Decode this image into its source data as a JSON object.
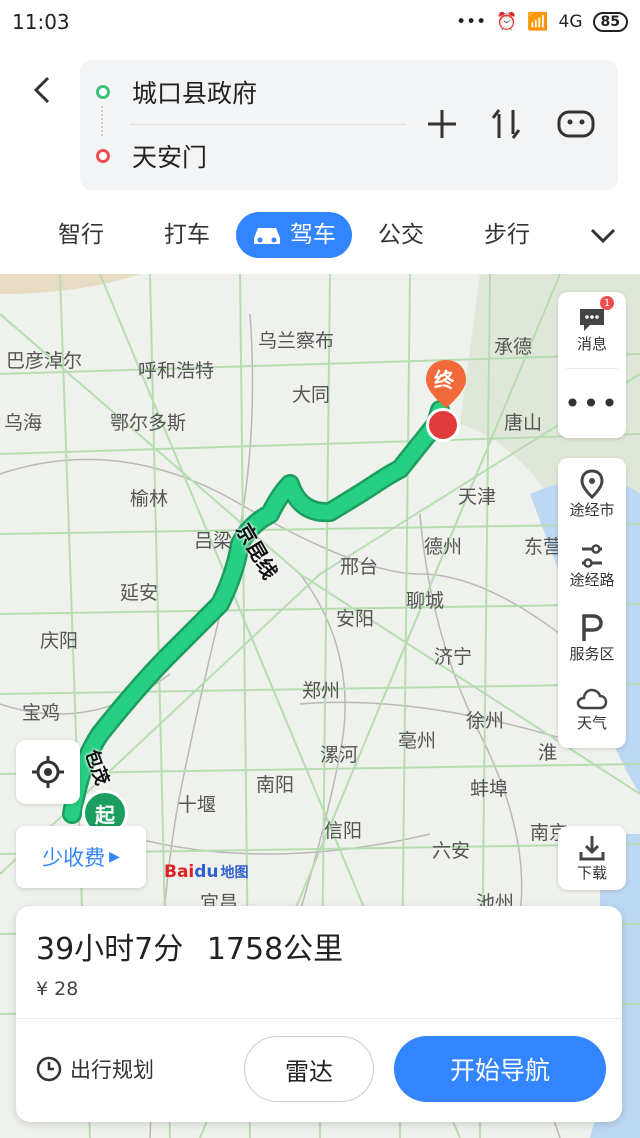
{
  "status": {
    "time": "11:03",
    "dots": "•••",
    "network": "4G",
    "battery": "85"
  },
  "route": {
    "start": "城口县政府",
    "end": "天安门"
  },
  "modes": [
    "智行",
    "打车",
    "驾车",
    "公交",
    "步行"
  ],
  "selected_mode": "驾车",
  "map": {
    "cities": [
      {
        "name": "乌兰察布"
      },
      {
        "name": "承德"
      },
      {
        "name": "巴彦淖尔"
      },
      {
        "name": "呼和浩特"
      },
      {
        "name": "大同"
      },
      {
        "name": "乌海"
      },
      {
        "name": "鄂尔多斯"
      },
      {
        "name": "唐山"
      },
      {
        "name": "天津"
      },
      {
        "name": "榆林"
      },
      {
        "name": "吕梁"
      },
      {
        "name": "德州"
      },
      {
        "name": "东营"
      },
      {
        "name": "延安"
      },
      {
        "name": "邢台"
      },
      {
        "name": "聊城"
      },
      {
        "name": "庆阳"
      },
      {
        "name": "安阳"
      },
      {
        "name": "济宁"
      },
      {
        "name": "郑州"
      },
      {
        "name": "宝鸡"
      },
      {
        "name": "徐州"
      },
      {
        "name": "漯河"
      },
      {
        "name": "亳州"
      },
      {
        "name": "南阳"
      },
      {
        "name": "淮"
      },
      {
        "name": "蚌埠"
      },
      {
        "name": "十堰"
      },
      {
        "name": "信阳"
      },
      {
        "name": "南京"
      },
      {
        "name": "六安"
      },
      {
        "name": "宜昌"
      },
      {
        "name": "池州"
      }
    ],
    "road_labels": [
      "京昆线",
      "包茂"
    ],
    "end_marker": "终",
    "start_marker": "起"
  },
  "side_tools": [
    {
      "label": "消息",
      "icon": "message-icon",
      "badge": "1"
    },
    {
      "label": "",
      "icon": "more-dots-icon"
    },
    {
      "label": "途经市",
      "icon": "waypoint-city-icon"
    },
    {
      "label": "途经路",
      "icon": "waypoint-road-icon"
    },
    {
      "label": "服务区",
      "icon": "service-area-icon"
    },
    {
      "label": "天气",
      "icon": "weather-icon"
    },
    {
      "label": "下载",
      "icon": "download-icon"
    }
  ],
  "toll_option": "少收费",
  "logo": {
    "bai": "Bai",
    "du": "du",
    "suffix": "地图"
  },
  "summary": {
    "duration": "39小时7分",
    "distance": "1758公里",
    "fee": "¥ 28"
  },
  "actions": {
    "plan": "出行规划",
    "radar": "雷达",
    "navigate": "开始导航"
  },
  "colors": {
    "accent": "#3385ff",
    "route": "#1ec27a"
  }
}
